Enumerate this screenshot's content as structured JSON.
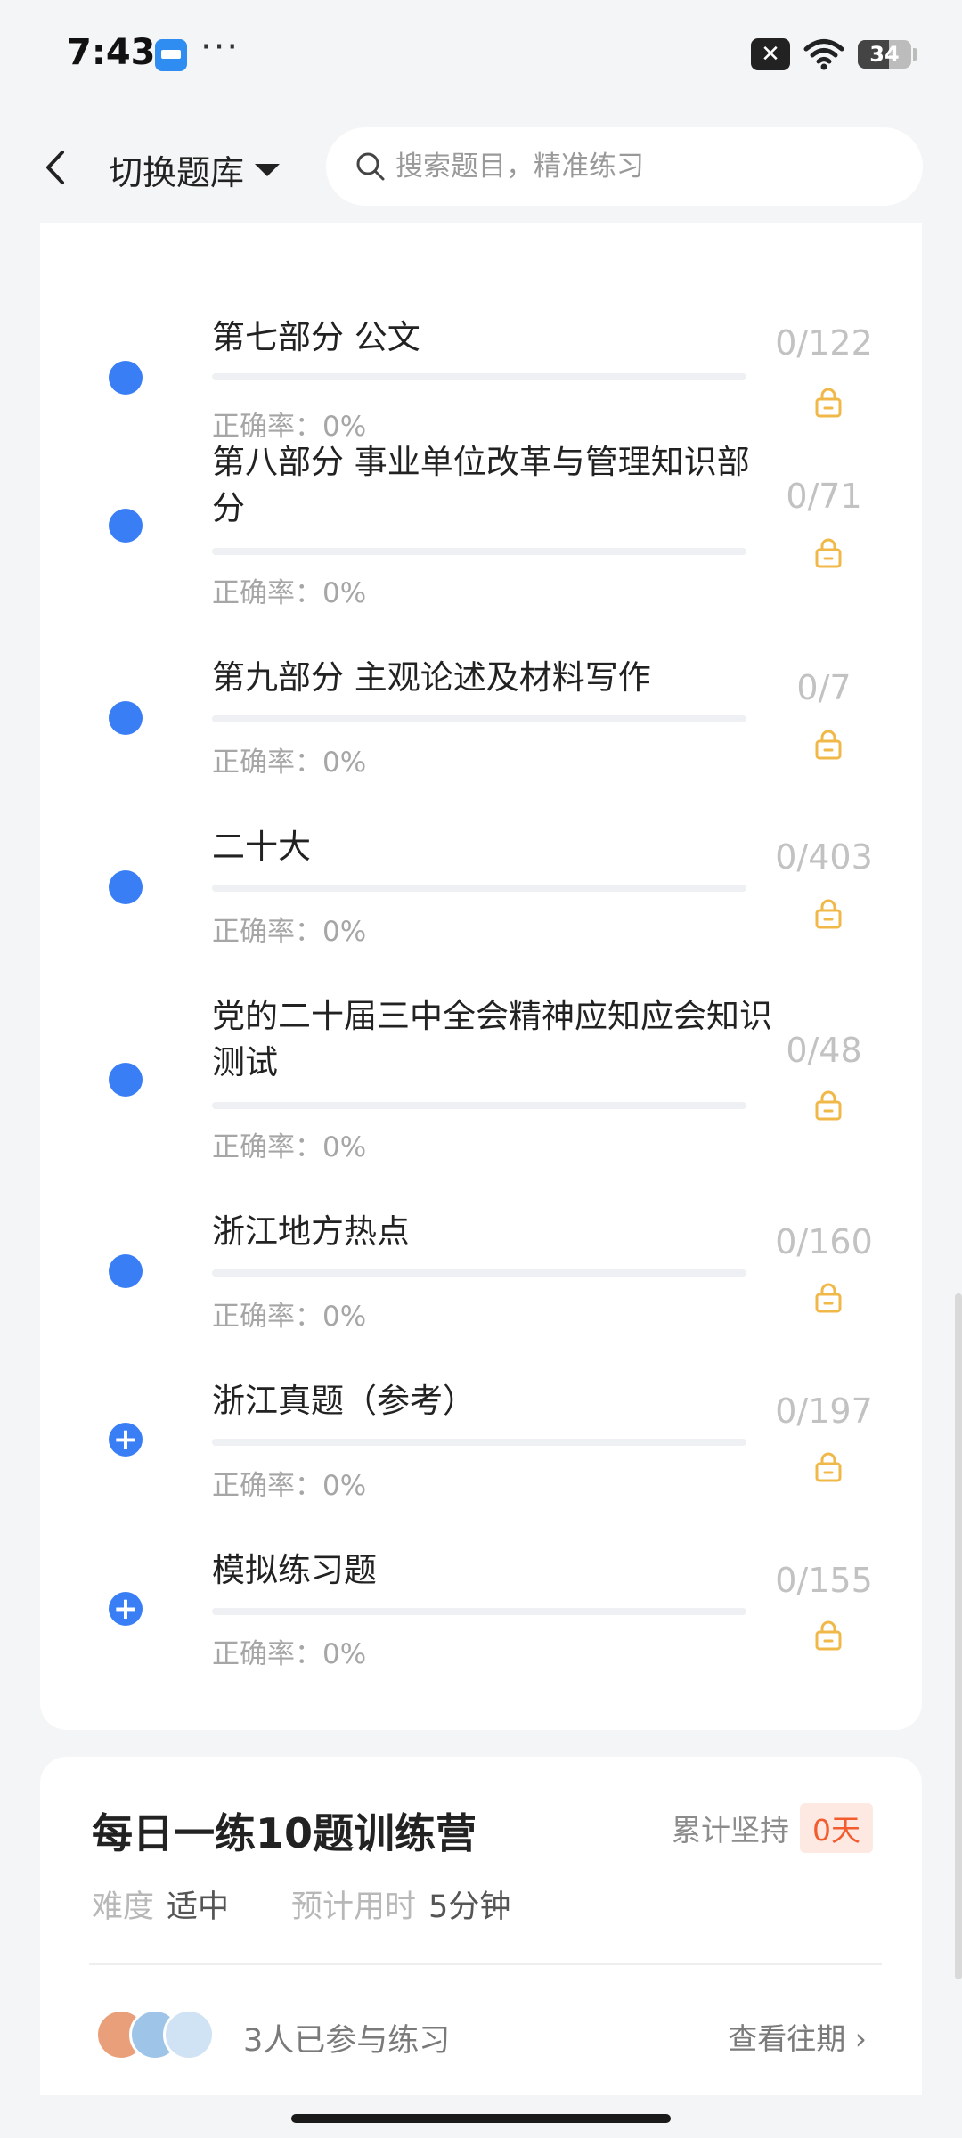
{
  "status_bar": {
    "time": "7:43",
    "dots": "···",
    "x_label": "✕",
    "battery": "34",
    "icons": [
      "app-badge-icon",
      "close-box-icon",
      "wifi-icon",
      "battery-icon"
    ]
  },
  "header": {
    "switch_label": "切换题库",
    "search_placeholder": "搜索题目，精准练习"
  },
  "sections": [
    {
      "title": "第七部分 公文",
      "accuracy": "正确率：0%",
      "count": "0/122",
      "icon": "dot"
    },
    {
      "title": "第八部分 事业单位改革与管理知识部分",
      "accuracy": "正确率：0%",
      "count": "0/71",
      "icon": "dot"
    },
    {
      "title": "第九部分 主观论述及材料写作",
      "accuracy": "正确率：0%",
      "count": "0/7",
      "icon": "dot"
    },
    {
      "title": "二十大",
      "accuracy": "正确率：0%",
      "count": "0/403",
      "icon": "dot"
    },
    {
      "title": "党的二十届三中全会精神应知应会知识测试",
      "accuracy": "正确率：0%",
      "count": "0/48",
      "icon": "dot"
    },
    {
      "title": "浙江地方热点",
      "accuracy": "正确率：0%",
      "count": "0/160",
      "icon": "dot"
    },
    {
      "title": "浙江真题（参考）",
      "accuracy": "正确率：0%",
      "count": "0/197",
      "icon": "plus"
    },
    {
      "title": "模拟练习题",
      "accuracy": "正确率：0%",
      "count": "0/155",
      "icon": "plus"
    }
  ],
  "camp": {
    "title": "每日一练10题训练营",
    "persist_label": "累计坚持",
    "persist_days": "0天",
    "difficulty_label": "难度",
    "difficulty_value": "适中",
    "time_label": "预计用时",
    "time_value": "5分钟",
    "participants": "3人已参与练习",
    "history_link": "查看往期"
  },
  "colors": {
    "accent": "#3a7ef5",
    "lock": "#f0b848",
    "days_badge_bg": "#fde9e2",
    "days_badge_text": "#f25c2f"
  }
}
